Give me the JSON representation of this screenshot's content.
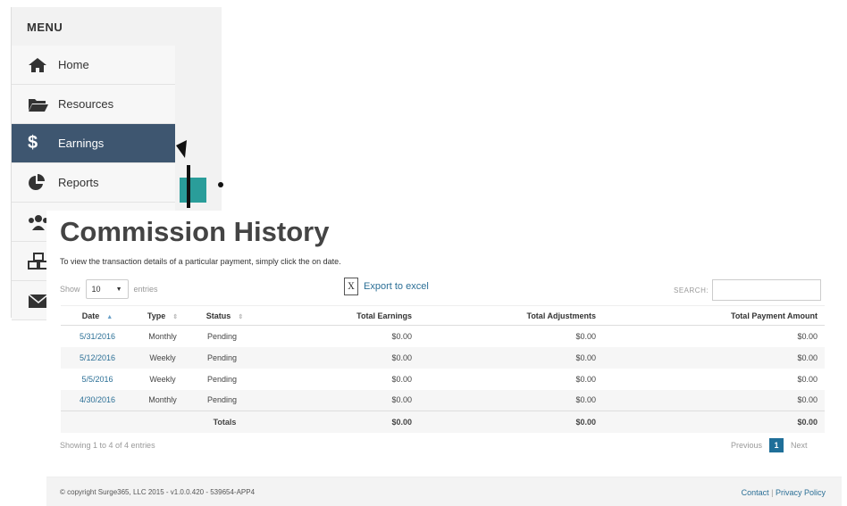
{
  "menu": {
    "header": "MENU",
    "items": [
      {
        "label": "Home",
        "icon": "home-icon",
        "active": false
      },
      {
        "label": "Resources",
        "icon": "folder-icon",
        "active": false
      },
      {
        "label": "Earnings",
        "icon": "dollar-icon",
        "active": true
      },
      {
        "label": "Reports",
        "icon": "pie-chart-icon",
        "active": false
      },
      {
        "label": "",
        "icon": "users-icon",
        "active": false
      },
      {
        "label": "",
        "icon": "cubes-icon",
        "active": false
      },
      {
        "label": "",
        "icon": "envelope-icon",
        "active": false
      }
    ]
  },
  "page": {
    "title": "Commission History",
    "subtitle": "To view the transaction details of a particular payment, simply click the on date."
  },
  "controls": {
    "show_label": "Show",
    "page_size": "10",
    "entries_label": "entries",
    "export_label": "Export to excel",
    "search_label": "SEARCH:",
    "search_value": ""
  },
  "table": {
    "headers": [
      "Date",
      "Type",
      "Status",
      "Total Earnings",
      "Total Adjustments",
      "Total Payment Amount"
    ],
    "rows": [
      [
        "5/31/2016",
        "Monthly",
        "Pending",
        "$0.00",
        "$0.00",
        "$0.00"
      ],
      [
        "5/12/2016",
        "Weekly",
        "Pending",
        "$0.00",
        "$0.00",
        "$0.00"
      ],
      [
        "5/5/2016",
        "Weekly",
        "Pending",
        "$0.00",
        "$0.00",
        "$0.00"
      ],
      [
        "4/30/2016",
        "Monthly",
        "Pending",
        "$0.00",
        "$0.00",
        "$0.00"
      ]
    ],
    "totals": {
      "label": "Totals",
      "earnings": "$0.00",
      "adjustments": "$0.00",
      "payment": "$0.00"
    }
  },
  "pagination": {
    "showing": "Showing 1 to 4 of 4 entries",
    "previous": "Previous",
    "current": "1",
    "next": "Next"
  },
  "footer": {
    "copyright": "© copyright Surge365, LLC 2015 - v1.0.0.420 - 539654-APP4",
    "contact": "Contact",
    "separator": "|",
    "privacy": "Privacy Policy"
  },
  "colors": {
    "active_menu": "#3e5670",
    "link": "#2b6f96",
    "page_button": "#1f6f99"
  }
}
